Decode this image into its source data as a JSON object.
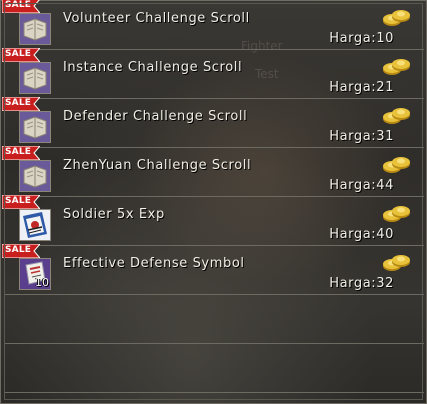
{
  "shop": {
    "sale_badge": "SALE",
    "background_text": [
      "Fighter",
      "Test"
    ],
    "items": [
      {
        "name": "Volunteer Challenge Scroll",
        "price": "Harga:10",
        "icon": "scroll-icon",
        "qty": ""
      },
      {
        "name": "Instance Challenge Scroll",
        "price": "Harga:21",
        "icon": "scroll-icon",
        "qty": ""
      },
      {
        "name": "Defender Challenge Scroll",
        "price": "Harga:31",
        "icon": "scroll-icon",
        "qty": ""
      },
      {
        "name": "ZhenYuan Challenge Scroll",
        "price": "Harga:44",
        "icon": "scroll-icon",
        "qty": ""
      },
      {
        "name": "Soldier 5x Exp",
        "price": "Harga:40",
        "icon": "exp-card-icon",
        "qty": ""
      },
      {
        "name": "Effective Defense Symbol",
        "price": "Harga:32",
        "icon": "defense-symbol-icon",
        "qty": "10"
      }
    ]
  },
  "colors": {
    "sale_red": "#c81e1e",
    "gold": "#e8c23a",
    "text": "#f2efe6",
    "divider": "#6d6a62"
  }
}
